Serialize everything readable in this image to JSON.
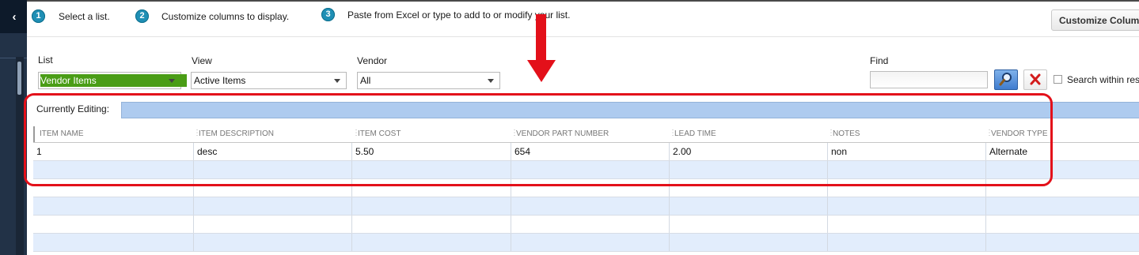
{
  "rail": {
    "collapse_icon": "chevron-left-icon",
    "collapse_glyph": "‹"
  },
  "steps": [
    {
      "number": "1",
      "text": "Select a list."
    },
    {
      "number": "2",
      "text": "Customize columns to display."
    },
    {
      "number": "3",
      "text": "Paste from Excel or type to add to or modify your list."
    }
  ],
  "header": {
    "customize_button": "Customize Columns"
  },
  "filters": {
    "list": {
      "label": "List",
      "value": "Vendor Items"
    },
    "view": {
      "label": "View",
      "value": "Active Items"
    },
    "vendor": {
      "label": "Vendor",
      "value": "All"
    }
  },
  "find": {
    "label": "Find",
    "value": "",
    "search_icon": "magnifier-icon",
    "clear_icon": "red-x-icon",
    "search_within_label": "Search within results"
  },
  "editing": {
    "label": "Currently Editing:",
    "value": ""
  },
  "grid": {
    "columns": [
      "ITEM NAME",
      "ITEM DESCRIPTION",
      "ITEM COST",
      "VENDOR PART NUMBER",
      "LEAD TIME",
      "NOTES",
      "VENDOR TYPE"
    ],
    "rows": [
      [
        "1",
        "desc",
        "5.50",
        "654",
        "2.00",
        "non",
        "Alternate"
      ]
    ],
    "empty_rows": 5
  },
  "colors": {
    "rail_bg": "#223247",
    "step_badge": "#1f8fb5",
    "list_select_highlight": "#4a9d16",
    "editing_bar": "#aecbef",
    "alt_row": "#e2edfc",
    "annotation_red": "#e3101a"
  }
}
